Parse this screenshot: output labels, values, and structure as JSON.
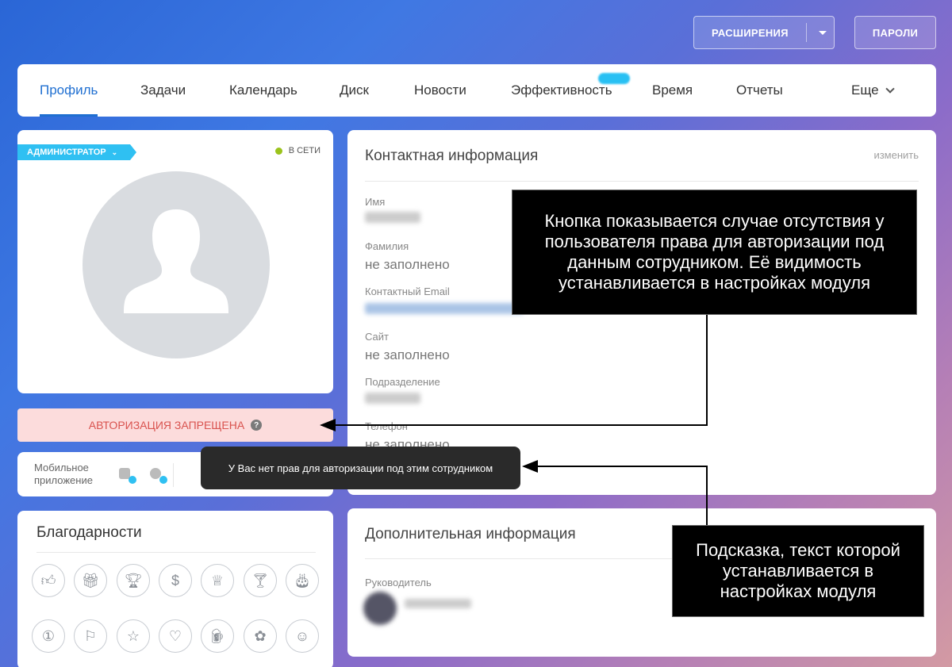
{
  "header": {
    "extensions_label": "РАСШИРЕНИЯ",
    "passwords_label": "ПАРОЛИ"
  },
  "nav": {
    "items": [
      "Профиль",
      "Задачи",
      "Календарь",
      "Диск",
      "Новости",
      "Эффективность",
      "Время",
      "Отчеты",
      "Еще"
    ]
  },
  "profile": {
    "role_badge": "АДМИНИСТРАТОР",
    "status": "В СЕТИ",
    "auth_denied": "АВТОРИЗАЦИЯ ЗАПРЕЩЕНА",
    "mobile_app": "Мобильное приложение"
  },
  "thanks": {
    "title": "Благодарности",
    "icons": [
      "thumbs-up-icon",
      "gift-icon",
      "trophy-icon",
      "money-bag-icon",
      "crown-icon",
      "cocktail-icon",
      "cake-icon",
      "number-one-icon",
      "flag-icon",
      "star-icon",
      "heart-icon",
      "beer-icon",
      "flower-icon",
      "smile-icon"
    ]
  },
  "contact": {
    "title": "Контактная информация",
    "edit": "изменить",
    "fields": [
      {
        "label": "Имя",
        "value": ""
      },
      {
        "label": "Фамилия",
        "value": "не заполнено"
      },
      {
        "label": "Контактный Email",
        "value": ""
      },
      {
        "label": "Сайт",
        "value": "не заполнено"
      },
      {
        "label": "Подразделение",
        "value": ""
      },
      {
        "label": "Телефон",
        "value": "не заполнено"
      }
    ]
  },
  "extra": {
    "title": "Дополнительная информация",
    "manager_label": "Руководитель"
  },
  "tooltip": "У Вас нет прав для авторизации под этим сотрудником",
  "callouts": {
    "button_note": "Кнопка показывается случае отсутствия у пользователя права для авторизации под данным сотрудником. Её видимость устанавливается в настройках модуля",
    "tooltip_note": "Подсказка, текст которой устанавливается в настройках модуля"
  },
  "colors": {
    "accent": "#1f6fd1",
    "admin_badge": "#2fc0f2",
    "online": "#9bc31c",
    "deny_bg": "#fcdcdc",
    "deny_text": "#d9534f"
  }
}
